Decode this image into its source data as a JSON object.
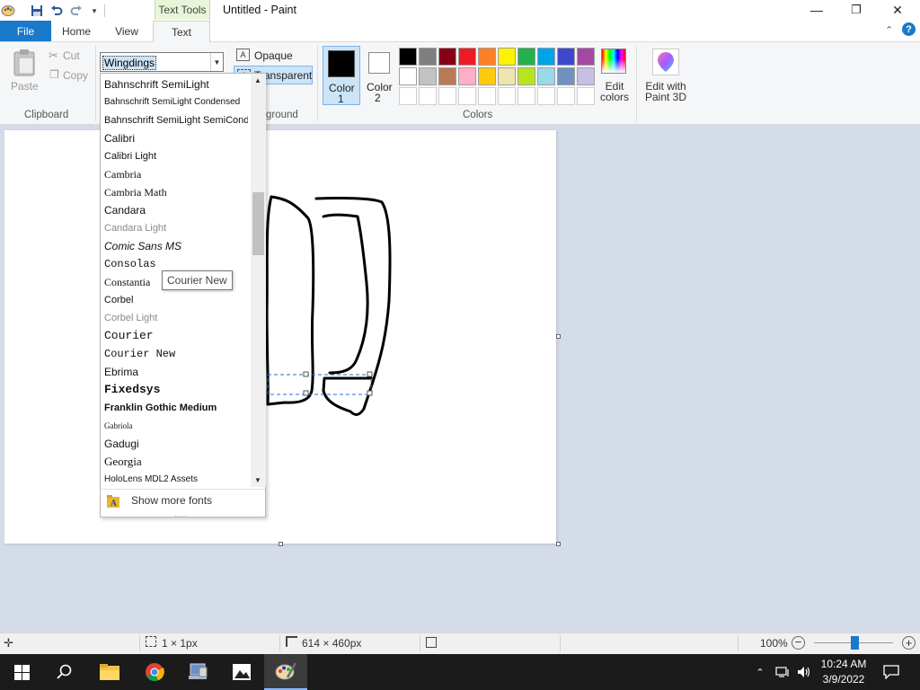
{
  "window": {
    "title": "Untitled - Paint",
    "contextual_tab": "Text Tools",
    "controls": [
      "—",
      "❐",
      "✕"
    ]
  },
  "tabs": {
    "file": "File",
    "home": "Home",
    "view": "View",
    "text": "Text"
  },
  "clipboard": {
    "paste": "Paste",
    "cut": "Cut",
    "copy": "Copy",
    "group_label": "Clipboard"
  },
  "font": {
    "current": "Wingdings",
    "items": [
      {
        "label": "Bahnschrift SemiLight",
        "family": "sans-serif",
        "size": 12
      },
      {
        "label": "Bahnschrift SemiLight Condensed",
        "family": "sans-serif",
        "size": 10
      },
      {
        "label": "Bahnschrift SemiLight SemiConde",
        "family": "sans-serif",
        "size": 11
      },
      {
        "label": "Calibri",
        "family": "sans-serif",
        "size": 12
      },
      {
        "label": "Calibri Light",
        "family": "sans-serif",
        "size": 11
      },
      {
        "label": "Cambria",
        "family": "serif",
        "size": 12
      },
      {
        "label": "Cambria Math",
        "family": "serif",
        "size": 12
      },
      {
        "label": "Candara",
        "family": "sans-serif",
        "size": 12
      },
      {
        "label": "Candara Light",
        "family": "sans-serif",
        "size": 11,
        "light": true
      },
      {
        "label": "Comic Sans MS",
        "family": "sans-serif",
        "size": 12,
        "italic": true
      },
      {
        "label": "Consolas",
        "family": "monospace",
        "size": 12
      },
      {
        "label": "Constantia",
        "family": "serif",
        "size": 12
      },
      {
        "label": "Corbel",
        "family": "sans-serif",
        "size": 11
      },
      {
        "label": "Corbel Light",
        "family": "sans-serif",
        "size": 11,
        "light": true
      },
      {
        "label": "Courier",
        "family": "monospace",
        "size": 13
      },
      {
        "label": "Courier New",
        "family": "monospace",
        "size": 12
      },
      {
        "label": "Ebrima",
        "family": "sans-serif",
        "size": 12
      },
      {
        "label": "Fixedsys",
        "family": "monospace",
        "size": 13,
        "bold": true
      },
      {
        "label": "Franklin Gothic Medium",
        "family": "sans-serif",
        "size": 11,
        "bold": true
      },
      {
        "label": "Gabriola",
        "family": "serif",
        "size": 9
      },
      {
        "label": "Gadugi",
        "family": "sans-serif",
        "size": 12
      },
      {
        "label": "Georgia",
        "family": "serif",
        "size": 13
      },
      {
        "label": "HoloLens MDL2 Assets",
        "family": "sans-serif",
        "size": 10
      }
    ],
    "show_more": "Show more fonts",
    "tooltip": "Courier New"
  },
  "background": {
    "opaque": "Opaque",
    "transparent": "Transparent",
    "group_label": "ground"
  },
  "colors": {
    "color1_label": "Color",
    "color1_num": "1",
    "color2_label": "Color",
    "color2_num": "2",
    "color1": "#000000",
    "color2": "#ffffff",
    "palette_row1": [
      "#000000",
      "#7f7f7f",
      "#880015",
      "#ed1c24",
      "#ff7f27",
      "#fff200",
      "#22b14c",
      "#00a2e8",
      "#3f48cc",
      "#a349a4"
    ],
    "palette_row2": [
      "#ffffff",
      "#c3c3c3",
      "#b97a57",
      "#ffaec9",
      "#ffc90e",
      "#efe4b0",
      "#b5e61d",
      "#99d9ea",
      "#7092be",
      "#c8bfe7"
    ],
    "group_label": "Colors",
    "edit_colors": "Edit colors",
    "paint3d": "Edit with Paint 3D"
  },
  "status": {
    "selection": "1 × 1px",
    "canvas_size": "614 × 460px",
    "zoom": "100%"
  },
  "clock": {
    "time": "10:24 AM",
    "date": "3/9/2022"
  }
}
